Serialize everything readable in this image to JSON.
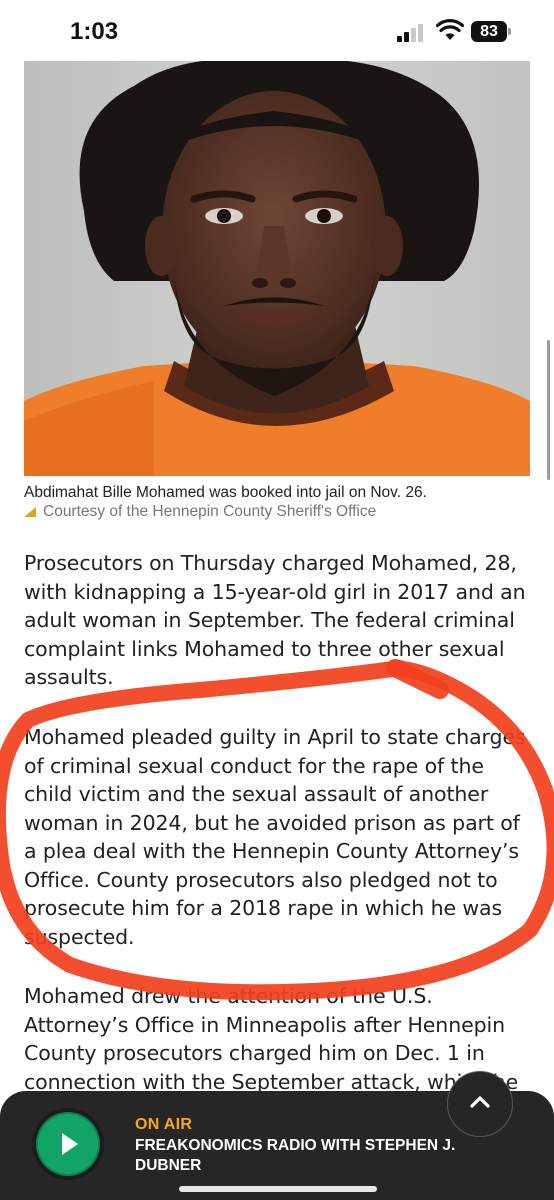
{
  "status_bar": {
    "time": "1:03",
    "battery": "83"
  },
  "photo": {
    "caption": "Abdimahat Bille Mohamed was booked into jail on Nov. 26.",
    "credit": "Courtesy of the Hennepin County Sheriff's Office"
  },
  "article": {
    "paragraphs": [
      "Prosecutors on Thursday charged Mohamed, 28, with kidnapping a 15-year-old girl in 2017 and an adult woman in September. The federal criminal complaint links Mohamed to three other sexual assaults.",
      "Mohamed pleaded guilty in April to state charges of criminal sexual conduct for the rape of the child victim and the sexual assault of another woman in 2024, but he avoided prison as part of a plea deal with the Hennepin County Attorney’s Office. County prosecutors also pledged not to prosecute him for a 2018 rape in which he was suspected.",
      "Mohamed drew the attention of the U.S. Attorney’s Office in Minneapolis after Hennepin County prosecutors charged him on Dec. 1 in connection with the September attack, which he"
    ]
  },
  "player": {
    "status": "ON AIR",
    "title": "FREAKONOMICS RADIO WITH STEPHEN J. DUBNER"
  },
  "colors": {
    "annotation": "#f2401c",
    "on_air": "#f4a81d",
    "play": "#12a467",
    "player_bg": "#262626"
  }
}
